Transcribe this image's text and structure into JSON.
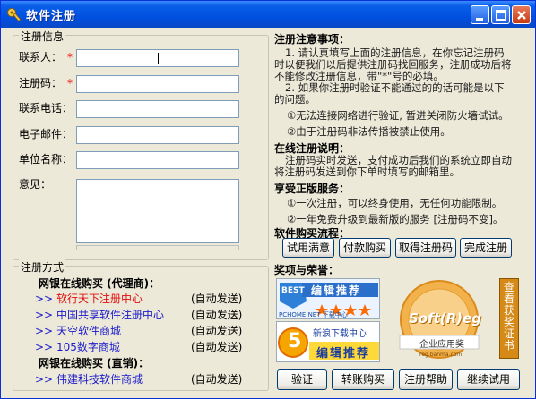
{
  "window": {
    "title": "软件注册"
  },
  "reg_info": {
    "legend": "注册信息",
    "fields": [
      {
        "label": "联系人：",
        "required": true,
        "value": ""
      },
      {
        "label": "注册码：",
        "required": true,
        "value": ""
      },
      {
        "label": "联系电话：",
        "required": false,
        "value": ""
      },
      {
        "label": "电子邮件：",
        "required": false,
        "value": ""
      },
      {
        "label": "单位名称：",
        "required": false,
        "value": ""
      }
    ],
    "remark_label": "意见：",
    "required_mark": "*"
  },
  "reg_method": {
    "legend": "注册方式",
    "online_agent_title": "网银在线购买 (代理商)：",
    "online_direct_title": "网银在线购买 (直销)：",
    "arrow": ">>",
    "agents": [
      {
        "name": "软行天下注册中心",
        "status": "(自动发送)",
        "color": "#e01010"
      },
      {
        "name": "中国共享软件注册中心",
        "status": "(自动发送)",
        "color": "#1a1acc"
      },
      {
        "name": "天空软件商城",
        "status": "(自动发送)",
        "color": "#1a1acc"
      },
      {
        "name": "105数字商城",
        "status": "(自动发送)",
        "color": "#1a1acc"
      }
    ],
    "direct": [
      {
        "name": "伟建科技软件商城",
        "status": "(自动发送)",
        "color": "#1a1acc"
      }
    ]
  },
  "notes": {
    "title": "注册注意事项：",
    "p1": "1. 请认真填写上面的注册信息，在你忘记注册码时以便我们以后提供注册码找回服务，注册成功后将不能修改注册信息，带\"*\"号的必填。",
    "p2": "2. 如果你注册时验证不能通过的的话可能是以下的问题。",
    "item1": "①无法连接网络进行验证, 暂进关闭防火墙试试。",
    "item2": "②由于注册码非法传播被禁止使用。"
  },
  "online": {
    "title": "在线注册说明：",
    "text": "注册码实时发送，支付成功后我们的系统立即自动将注册码发送到你下单时填写的邮箱里。"
  },
  "service": {
    "title": "享受正版服务：",
    "item1": "①一次注册，可以终身使用，无任何功能限制。",
    "item2": "②一年免费升级到最新版的服务 [注册码不变]。"
  },
  "flow": {
    "title": "软件购买流程：",
    "steps": [
      "试用满意",
      "付款购买",
      "取得注册码",
      "完成注册"
    ]
  },
  "awards": {
    "title": "奖项与荣誉：",
    "a1_top": "编辑推荐",
    "a1_site": "PCHOME.NET 下载中心",
    "a1_best": "BEST",
    "a2_top": "新浪下载中心",
    "a2_main": "编辑推荐",
    "a2_num": "5",
    "a3_main": "Soft(R)eg",
    "a3_sub": "企业应用奖",
    "a3_url": "reg.banma.com",
    "view_cert": "查看获奖证书"
  },
  "buttons": {
    "verify": "验证",
    "transfer": "转账购买",
    "help": "注册帮助",
    "continue": "继续试用"
  },
  "colors": {
    "title_bar": "#0050e0",
    "accent_red": "#e01010",
    "link_blue": "#1a1acc",
    "cert": "#d58a18"
  }
}
